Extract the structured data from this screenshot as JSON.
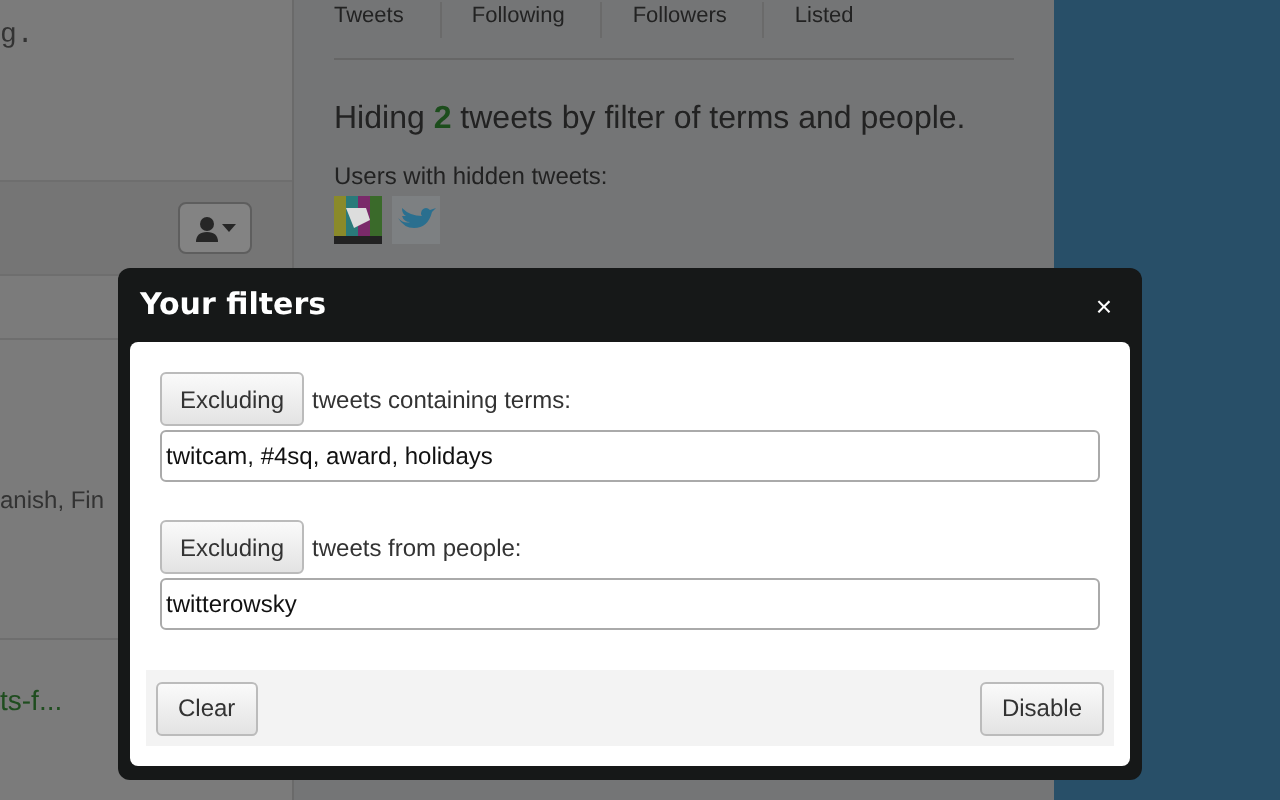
{
  "background": {
    "left_texts": [
      {
        "text": "g.",
        "kind": "plain"
      },
      {
        "text": "anish, Fin",
        "kind": "plain"
      },
      {
        "text": "ts-f...",
        "kind": "link"
      }
    ],
    "tabs": [
      "Tweets",
      "Following",
      "Followers",
      "Listed"
    ],
    "summary": "Hiding **2** tweets by filter of terms and people.",
    "users_label": "Users with hidden tweets:"
  },
  "dialog": {
    "title": "Your filters",
    "close": "×",
    "filters": [
      {
        "mode": "Excluding",
        "label": "tweets containing terms:",
        "value": "twitcam, #4sq, award, holidays"
      },
      {
        "mode": "Excluding",
        "label": "tweets from people:",
        "value": "twitterowsky"
      }
    ],
    "buttons": [
      "Clear",
      "Disable"
    ]
  }
}
